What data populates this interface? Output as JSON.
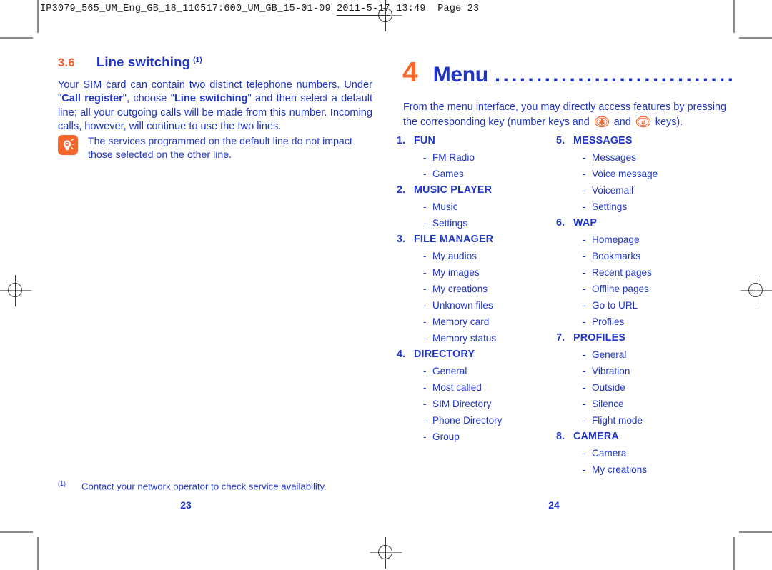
{
  "slug": {
    "prefix": "IP3079_565_UM_Eng_GB_18_110517:600_UM_GB_15-01-09",
    "date": "2011-5-17",
    "time": "13:49",
    "page_label": "Page 23"
  },
  "colors": {
    "blue": "#1F35C4",
    "orange": "#F4662B",
    "orange_dark": "#F15A29"
  },
  "left_page": {
    "section_number": "3.6",
    "section_title": "Line switching",
    "section_footnote_mark": "(1)",
    "body_parts": [
      {
        "text": "Your SIM card can contain two distinct telephone numbers. Under \"",
        "bold": false
      },
      {
        "text": "Call register",
        "bold": true
      },
      {
        "text": "\", choose \"",
        "bold": false
      },
      {
        "text": "Line switching",
        "bold": true
      },
      {
        "text": "\" and then select a default line; all your outgoing calls will be made from this number. Incoming calls, however, will continue to use the two lines.",
        "bold": false
      }
    ],
    "note": {
      "icon": "tip-lightbulb-icon",
      "text": "The services programmed on the default line do not impact those selected on the other line."
    },
    "footnote": {
      "mark": "(1)",
      "text": "Contact your network operator to check service availability."
    },
    "folio": "23"
  },
  "right_page": {
    "chapter_number": "4",
    "chapter_title": "Menu",
    "chapter_dots": "......................................",
    "intro": {
      "part1": "From the menu interface, you may directly access features by pressing the corresponding key (number keys and",
      "star_key_icon": "star-key-icon",
      "conjunction": "and",
      "hash_key_icon": "hash-key-icon",
      "part2": "keys)."
    },
    "menu_columns": [
      {
        "groups": [
          {
            "number": "1.",
            "title": "FUN",
            "items": [
              "FM Radio",
              "Games"
            ]
          },
          {
            "number": "2.",
            "title": "MUSIC PLAYER",
            "items": [
              "Music",
              "Settings"
            ]
          },
          {
            "number": "3.",
            "title": "FILE MANAGER",
            "items": [
              "My audios",
              "My images",
              "My creations",
              "Unknown files",
              "Memory card",
              "Memory status"
            ]
          },
          {
            "number": "4.",
            "title": "DIRECTORY",
            "items": [
              "General",
              "Most called",
              "SIM Directory",
              "Phone Directory",
              "Group"
            ]
          }
        ]
      },
      {
        "groups": [
          {
            "number": "5.",
            "title": "MESSAGES",
            "items": [
              "Messages",
              "Voice message",
              "Voicemail",
              "Settings"
            ]
          },
          {
            "number": "6.",
            "title": "WAP",
            "items": [
              "Homepage",
              "Bookmarks",
              "Recent pages",
              "Offline pages",
              "Go to URL",
              "Profiles"
            ]
          },
          {
            "number": "7.",
            "title": "PROFILES",
            "items": [
              "General",
              "Vibration",
              "Outside",
              "Silence",
              "Flight mode"
            ]
          },
          {
            "number": "8.",
            "title": "CAMERA",
            "items": [
              "Camera",
              "My creations"
            ]
          }
        ]
      }
    ],
    "folio": "24"
  }
}
